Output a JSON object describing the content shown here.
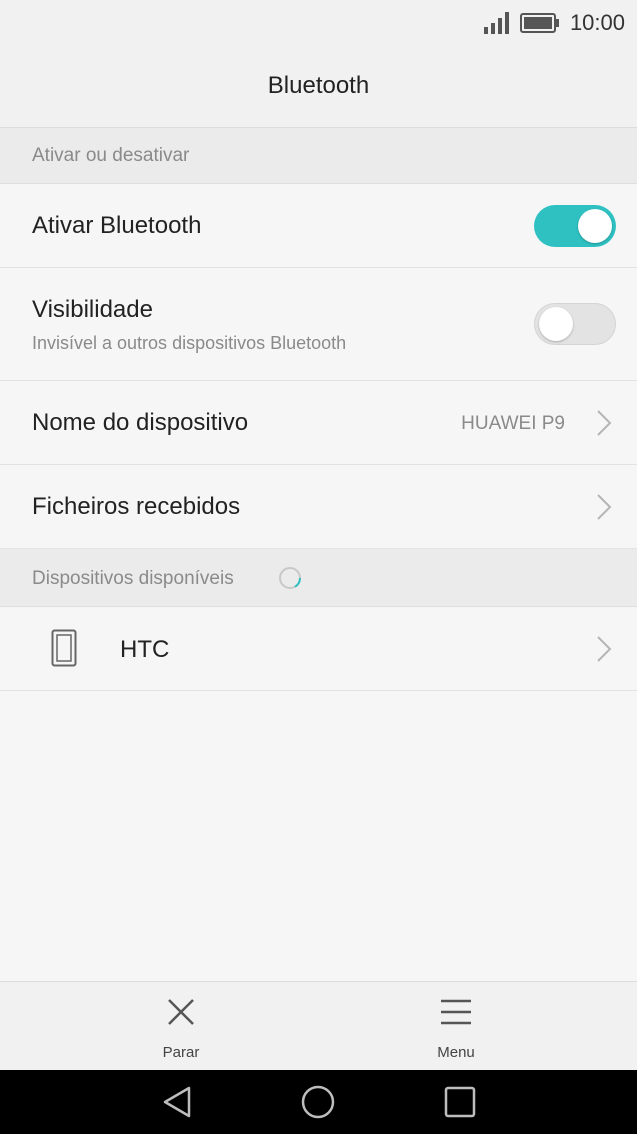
{
  "status": {
    "time": "10:00"
  },
  "header": {
    "title": "Bluetooth"
  },
  "sections": {
    "toggle_section": "Ativar ou desativar",
    "devices_section": "Dispositivos disponíveis"
  },
  "settings": {
    "bluetooth": {
      "label": "Ativar Bluetooth",
      "enabled": true
    },
    "visibility": {
      "label": "Visibilidade",
      "subtitle": "Invisível a outros dispositivos Bluetooth",
      "enabled": false
    },
    "device_name": {
      "label": "Nome do dispositivo",
      "value": "HUAWEI P9"
    },
    "received_files": {
      "label": "Ficheiros recebidos"
    }
  },
  "devices": [
    {
      "name": "HTC",
      "icon": "phone-icon"
    }
  ],
  "bottom_bar": {
    "stop": {
      "label": "Parar",
      "icon": "close-icon"
    },
    "menu": {
      "label": "Menu",
      "icon": "menu-icon"
    }
  },
  "colors": {
    "accent": "#2fc1c2"
  }
}
